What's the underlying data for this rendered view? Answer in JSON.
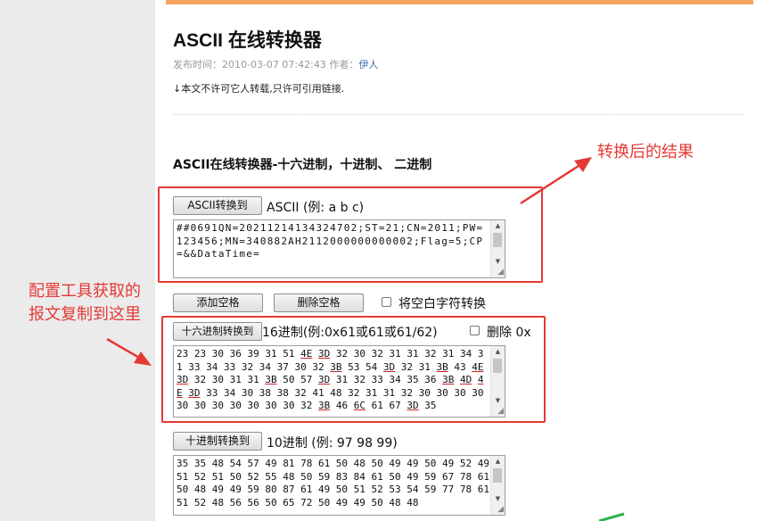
{
  "article": {
    "title": "ASCII 在线转换器",
    "meta_prefix": "发布时间：",
    "date": "2010-03-07 07:42:43",
    "author_label": " 作者：",
    "author": "伊人",
    "notice": "↓本文不许可它人转载,只许可引用链接."
  },
  "tool": {
    "heading": "ASCII在线转换器-十六进制，十进制、 二进制",
    "ascii": {
      "button": "ASCII转换到",
      "label": "ASCII (例: a b c)",
      "value": "##0691QN=20211214134324702;ST=21;CN=2011;PW=123456;MN=340882AH2112000000000002;Flag=5;CP=&&DataTime="
    },
    "actions": {
      "add_space": "添加空格",
      "remove_space": "删除空格",
      "whitespace_checkbox": "将空白字符转换"
    },
    "hex": {
      "button": "十六进制转换到",
      "label": "16进制(例:0x61或61或61/62)",
      "remove_0x": "删除 0x",
      "value": "23 23 30 36 39 31 51 4E 3D 32 30 32 31 31 32 31 34 31 33 34 33 32 34 37 30 32 3B 53 54 3D 32 31 3B 43 4E 3D 32 30 31 31 3B 50 57 3D 31 32 33 34 35 36 3B 4D 4E 3D 33 34 30 38 38 32 41 48 32 31 31 32 30 30 30 30 30 30 30 30 30 30 30 32 3B 46 6C 61 67 3D 35"
    },
    "dec": {
      "button": "十进制转换到",
      "label": "10进制 (例: 97 98 99)",
      "value": "35 35 48 54 57 49 81 78 61 50 48 50 49 49 50 49 52 49 51 52 51 50 52 55 48 50 59 83 84 61 50 49 59 67 78 61 50 48 49 49 59 80 87 61 49 50 51 52 53 54 59 77 78 61 51 52 48 56 56 50 65 72 50 49 49 50 48 48"
    }
  },
  "annotations": {
    "result_note": "转换后的结果",
    "source_note": "配置工具获取的报文复制到这里"
  },
  "colors": {
    "highlight": "#e53935",
    "topbar": "#f4a55b",
    "author_link": "#3b6cb0"
  }
}
